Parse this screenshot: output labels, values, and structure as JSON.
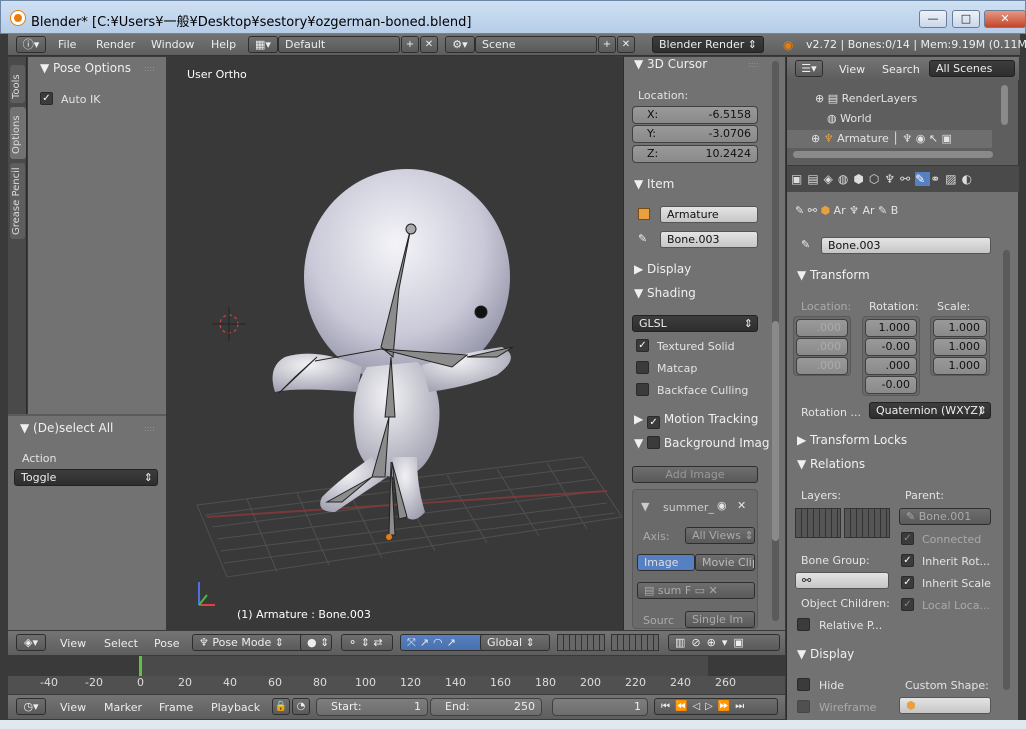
{
  "window": {
    "title": "Blender* [C:¥Users¥一般¥Desktop¥sestory¥ozgerman-boned.blend]",
    "min": "—",
    "max": "□",
    "close": "✕"
  },
  "menubar": {
    "items": [
      "File",
      "Render",
      "Window",
      "Help"
    ],
    "layout": "Default",
    "scene": "Scene",
    "engine": "Blender Render",
    "stats": "v2.72 | Bones:0/14 | Mem:9.19M (0.11M"
  },
  "tool_tabs": [
    "Tools",
    "Options",
    "Grease Pencil"
  ],
  "tool_shelf": {
    "pose_options": "Pose Options",
    "auto_ik": "Auto IK",
    "deselect_all": "(De)select All",
    "action_label": "Action",
    "action_value": "Toggle"
  },
  "viewport": {
    "view_name": "User Ortho",
    "status": "(1) Armature : Bone.003"
  },
  "properties": {
    "cursor_title": "3D Cursor",
    "location_label": "Location:",
    "x_label": "X:",
    "x": "-6.5158",
    "y_label": "Y:",
    "y": "-3.0706",
    "z_label": "Z:",
    "z": "10.2424",
    "item_title": "Item",
    "object_name": "Armature",
    "bone_name": "Bone.003",
    "display": "Display",
    "shading": "Shading",
    "shading_mode": "GLSL",
    "textured_solid": "Textured Solid",
    "matcap": "Matcap",
    "backface_culling": "Backface Culling",
    "motion_tracking": "Motion Tracking",
    "background_images": "Background Imag",
    "add_image": "Add Image",
    "image_name": "summer_",
    "axis_label": "Axis:",
    "axis_value": "All Views",
    "image_tab": "Image",
    "movie_tab": "Movie Clip",
    "source_label": "Sourc",
    "source_value": "Single Im",
    "file_name": "sum",
    "file_f": "F"
  },
  "outliner": {
    "view": "View",
    "search": "Search",
    "scenes": "All Scenes",
    "items": [
      "RenderLayers",
      "World",
      "Armature"
    ]
  },
  "bone_props": {
    "breadcrumb": [
      "Ar",
      "Ar",
      "B"
    ],
    "bone_name": "Bone.003",
    "transform": "Transform",
    "location": "Location:",
    "rotation": "Rotation:",
    "scale": "Scale:",
    "loc_values": [
      ".000",
      ".000",
      ".000"
    ],
    "rot_values": [
      "1.000",
      "-0.00",
      ".000",
      "-0.00"
    ],
    "scale_values": [
      "1.000",
      "1.000",
      "1.000"
    ],
    "rotation_mode_label": "Rotation ...",
    "rotation_mode": "Quaternion (WXYZ)",
    "transform_locks": "Transform Locks",
    "relations": "Relations",
    "layers": "Layers:",
    "parent": "Parent:",
    "parent_value": "Bone.001",
    "connected": "Connected",
    "bone_group": "Bone Group:",
    "inherit_rot": "Inherit Rot...",
    "inherit_scale": "Inherit Scale",
    "object_children": "Object Children:",
    "local_loca": "Local Loca...",
    "relative_p": "Relative P...",
    "display": "Display",
    "hide": "Hide",
    "wireframe": "Wireframe",
    "custom_shape": "Custom Shape:"
  },
  "view_header": {
    "items": [
      "View",
      "Select",
      "Pose"
    ],
    "mode": "Pose Mode",
    "orientation": "Global"
  },
  "timeline": {
    "ticks": [
      "-40",
      "-20",
      "0",
      "20",
      "40",
      "60",
      "80",
      "100",
      "120",
      "140",
      "160",
      "180",
      "200",
      "220",
      "240",
      "260"
    ],
    "current_frame": "1",
    "start_label": "Start:",
    "start": "1",
    "end_label": "End:",
    "end": "250",
    "menu": [
      "View",
      "Marker",
      "Frame",
      "Playback"
    ]
  }
}
